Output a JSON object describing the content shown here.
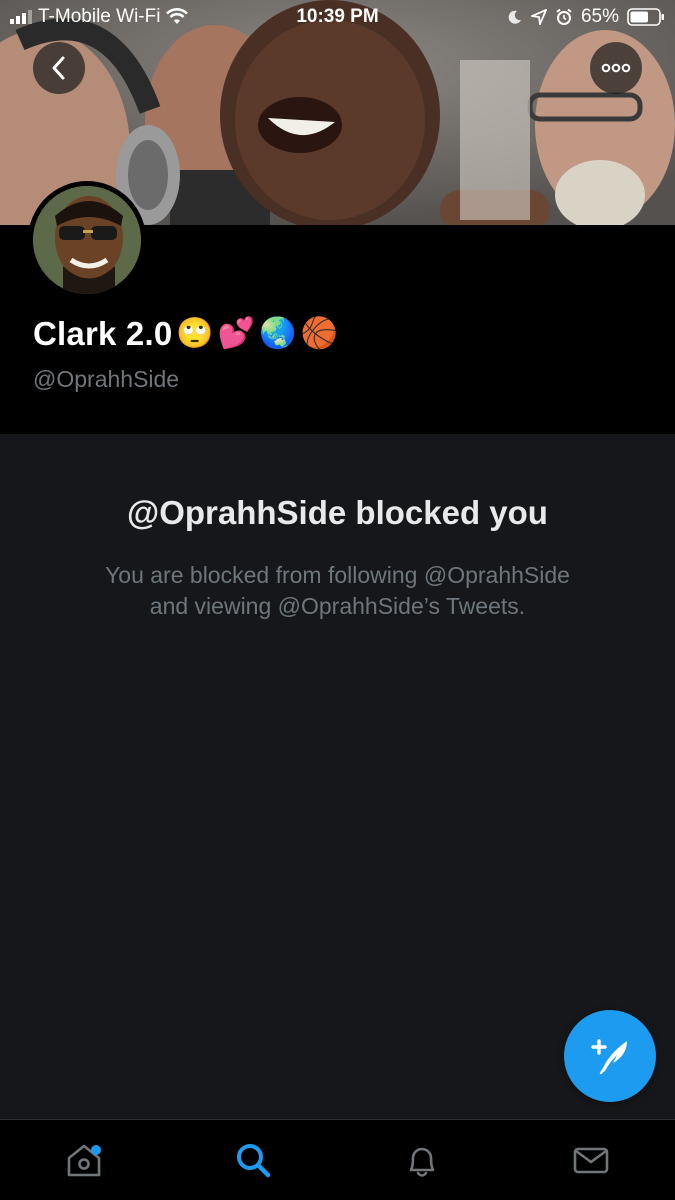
{
  "status_bar": {
    "carrier": "T-Mobile Wi-Fi",
    "time": "10:39 PM",
    "battery": "65%",
    "battery_level": 0.65
  },
  "profile": {
    "display_name": "Clark 2.0",
    "name_emojis": [
      "🙄",
      "💕",
      "🌏",
      "🏀"
    ],
    "handle": "@OprahhSide"
  },
  "blocked": {
    "title": "@OprahhSide blocked you",
    "line1": "You are blocked from following @OprahhSide",
    "line2": "and viewing @OprahhSide’s Tweets."
  },
  "icons": {
    "back": "chevron-left-icon",
    "more": "more-horizontal-icon",
    "compose": "compose-tweet-icon",
    "tabs": [
      "home-icon",
      "search-icon",
      "notifications-icon",
      "messages-icon"
    ]
  },
  "colors": {
    "accent": "#1d9bf0",
    "background": "#16171a",
    "header_bg": "#000000",
    "secondary_text": "#71767b"
  },
  "tabs": {
    "active": "search",
    "home_has_dot": true
  }
}
